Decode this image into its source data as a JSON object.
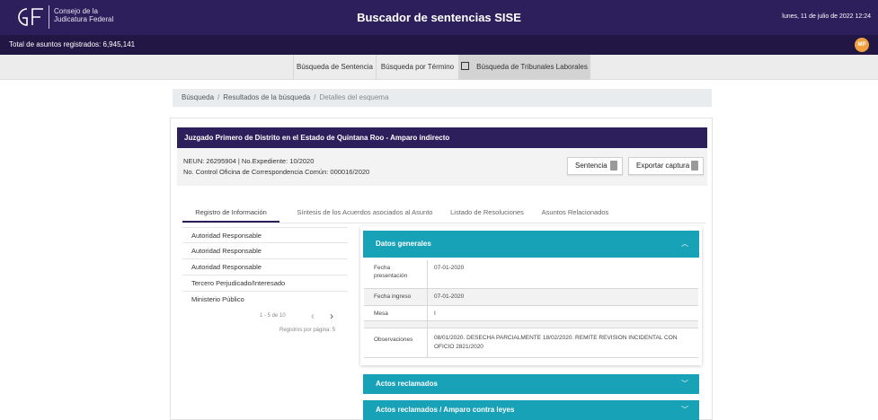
{
  "header": {
    "org_line1": "Consejo de la",
    "org_line2": "Judicatura Federal",
    "title": "Buscador de sentencias SISE",
    "date": "lunes, 11 de julio de 2022 12:24"
  },
  "subheader": {
    "total": "Total de asuntos registrados: 6,945,141",
    "avatar": "MP"
  },
  "nav": {
    "items": [
      {
        "label": "Búsqueda de Sentencia"
      },
      {
        "label": "Búsqueda por Término"
      },
      {
        "label": "Búsqueda de Tribunales Laborales",
        "icon": "external-link-icon"
      }
    ]
  },
  "breadcrumb": {
    "items": [
      "Búsqueda",
      "Resultados de la búsqueda",
      "Detalles del esquema"
    ]
  },
  "card": {
    "title": "Juzgado Primero de Distrito en el Estado de Quintana Roo - Amparo indirecto",
    "info_line1": "NEUN: 26295904 | No.Expediente: 10/2020",
    "info_line2": "No. Control Oficina de Correspondencia Común: 000016/2020",
    "sentencia_button": "Sentencia",
    "exportar_button": "Exportar captura"
  },
  "tabs": [
    {
      "label": "Registro de Información"
    },
    {
      "label": "Síntesis de los Acuerdos asociados al Asunto"
    },
    {
      "label": "Listado de Resoluciones"
    },
    {
      "label": "Asuntos Relacionados"
    }
  ],
  "list": {
    "items": [
      "Autoridad Responsable",
      "Autoridad Responsable",
      "Autoridad Responsable",
      "Tercero Perjudicado/Interesado",
      "Ministerio Público"
    ],
    "range": "1 - 5 de 10",
    "per_page": "Registros por página: 5"
  },
  "datos_generales": {
    "title": "Datos generales",
    "rows": [
      {
        "label": "Fecha presentación",
        "value": "07-01-2020"
      },
      {
        "label": "Fecha ingreso",
        "value": "07-01-2020"
      },
      {
        "label": "Mesa",
        "value": "I"
      },
      {
        "label": "",
        "value": ""
      },
      {
        "label": "Observaciones",
        "value": "08/01/2020. DESECHA PARCIALMENTE 18/02/2020. REMITE REVISION INCIDENTAL CON OFICIO 2821/2020"
      }
    ]
  },
  "sections": {
    "actos": "Actos reclamados",
    "actos_leyes": "Actos reclamados / Amparo contra leyes"
  },
  "colors": {
    "header": "#2d1f5c",
    "teal": "#17a2b8",
    "avatar": "#f0a040"
  }
}
